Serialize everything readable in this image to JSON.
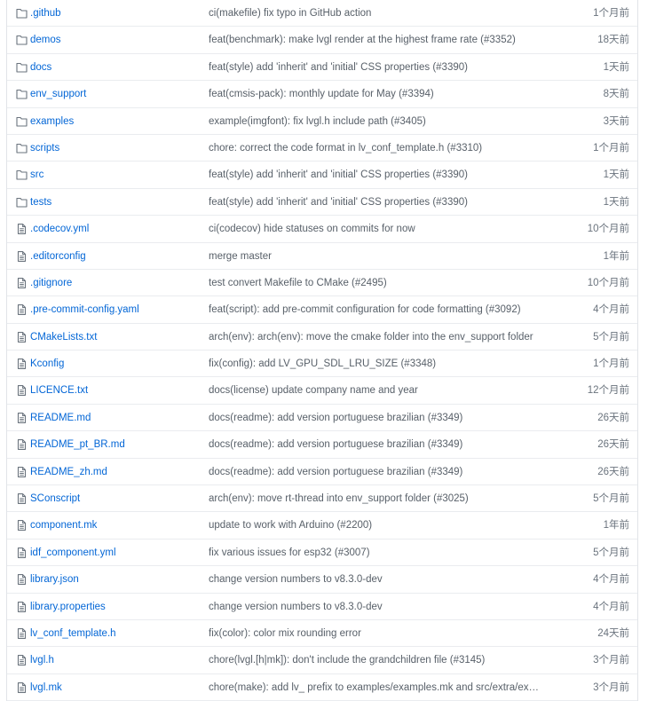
{
  "files": [
    {
      "type": "folder",
      "icon": "folder-icon",
      "name": ".github",
      "message": "ci(makefile) fix typo in GitHub action",
      "age": "1个月前"
    },
    {
      "type": "folder",
      "icon": "folder-icon",
      "name": "demos",
      "message": "feat(benchmark): make lvgl render at the highest frame rate (#3352)",
      "age": "18天前"
    },
    {
      "type": "folder",
      "icon": "folder-icon",
      "name": "docs",
      "message": "feat(style) add 'inherit' and 'initial' CSS properties (#3390)",
      "age": "1天前"
    },
    {
      "type": "folder",
      "icon": "folder-icon",
      "name": "env_support",
      "message": "feat(cmsis-pack): monthly update for May (#3394)",
      "age": "8天前"
    },
    {
      "type": "folder",
      "icon": "folder-icon",
      "name": "examples",
      "message": "example(imgfont): fix lvgl.h include path (#3405)",
      "age": "3天前"
    },
    {
      "type": "folder",
      "icon": "folder-icon",
      "name": "scripts",
      "message": "chore: correct the code format in lv_conf_template.h (#3310)",
      "age": "1个月前"
    },
    {
      "type": "folder",
      "icon": "folder-icon",
      "name": "src",
      "message": "feat(style) add 'inherit' and 'initial' CSS properties (#3390)",
      "age": "1天前"
    },
    {
      "type": "folder",
      "icon": "folder-icon",
      "name": "tests",
      "message": "feat(style) add 'inherit' and 'initial' CSS properties (#3390)",
      "age": "1天前"
    },
    {
      "type": "file",
      "icon": "file-icon",
      "name": ".codecov.yml",
      "message": "ci(codecov) hide statuses on commits for now",
      "age": "10个月前"
    },
    {
      "type": "file",
      "icon": "file-icon",
      "name": ".editorconfig",
      "message": "merge master",
      "age": "1年前"
    },
    {
      "type": "file",
      "icon": "file-icon",
      "name": ".gitignore",
      "message": "test convert Makefile to CMake (#2495)",
      "age": "10个月前"
    },
    {
      "type": "file",
      "icon": "file-icon",
      "name": ".pre-commit-config.yaml",
      "message": "feat(script): add pre-commit configuration for code formatting (#3092)",
      "age": "4个月前"
    },
    {
      "type": "file",
      "icon": "file-icon",
      "name": "CMakeLists.txt",
      "message": "arch(env): arch(env): move the cmake folder into the env_support folder",
      "age": "5个月前"
    },
    {
      "type": "file",
      "icon": "file-icon",
      "name": "Kconfig",
      "message": "fix(config): add LV_GPU_SDL_LRU_SIZE (#3348)",
      "age": "1个月前"
    },
    {
      "type": "file",
      "icon": "file-icon",
      "name": "LICENCE.txt",
      "message": "docs(license) update company name and year",
      "age": "12个月前"
    },
    {
      "type": "file",
      "icon": "file-icon",
      "name": "README.md",
      "message": "docs(readme): add version portuguese brazilian (#3349)",
      "age": "26天前"
    },
    {
      "type": "file",
      "icon": "file-icon",
      "name": "README_pt_BR.md",
      "message": "docs(readme): add version portuguese brazilian (#3349)",
      "age": "26天前"
    },
    {
      "type": "file",
      "icon": "file-icon",
      "name": "README_zh.md",
      "message": "docs(readme): add version portuguese brazilian (#3349)",
      "age": "26天前"
    },
    {
      "type": "file",
      "icon": "file-icon",
      "name": "SConscript",
      "message": "arch(env): move rt-thread into env_support folder (#3025)",
      "age": "5个月前"
    },
    {
      "type": "file",
      "icon": "file-icon",
      "name": "component.mk",
      "message": "update to work with Arduino (#2200)",
      "age": "1年前"
    },
    {
      "type": "file",
      "icon": "file-icon",
      "name": "idf_component.yml",
      "message": "fix various issues for esp32 (#3007)",
      "age": "5个月前"
    },
    {
      "type": "file",
      "icon": "file-icon",
      "name": "library.json",
      "message": "change version numbers to v8.3.0-dev",
      "age": "4个月前"
    },
    {
      "type": "file",
      "icon": "file-icon",
      "name": "library.properties",
      "message": "change version numbers to v8.3.0-dev",
      "age": "4个月前"
    },
    {
      "type": "file",
      "icon": "file-icon",
      "name": "lv_conf_template.h",
      "message": "fix(color): color mix rounding error",
      "age": "24天前"
    },
    {
      "type": "file",
      "icon": "file-icon",
      "name": "lvgl.h",
      "message": "chore(lvgl.[h|mk]): don't include the grandchildren file (#3145)",
      "age": "3个月前"
    },
    {
      "type": "file",
      "icon": "file-icon",
      "name": "lvgl.mk",
      "message": "chore(make): add lv_ prefix to examples/examples.mk and src/extra/extr...",
      "age": "3个月前"
    }
  ],
  "colors": {
    "link": "#0366d6",
    "message": "#586069",
    "age": "#6a737d",
    "icon": "#6a737d",
    "border": "#eaecef"
  }
}
